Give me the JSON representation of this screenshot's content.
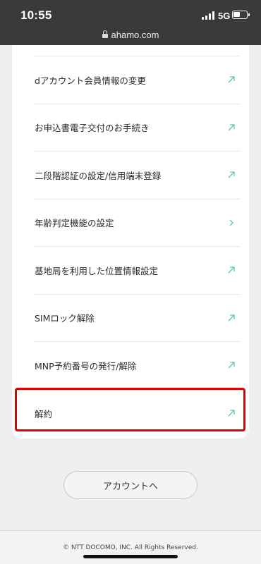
{
  "status_bar": {
    "time": "10:55",
    "network": "5G"
  },
  "browser": {
    "url": "ahamo.com"
  },
  "menu": {
    "items": [
      {
        "label": "dアカウント会員情報の変更",
        "icon": "external-link-arrow-icon"
      },
      {
        "label": "お申込書電子交付のお手続き",
        "icon": "external-link-arrow-icon"
      },
      {
        "label": "二段階認証の設定/信用端末登録",
        "icon": "external-link-arrow-icon"
      },
      {
        "label": "年齢判定機能の設定",
        "icon": "chevron-right-icon"
      },
      {
        "label": "基地局を利用した位置情報設定",
        "icon": "external-link-arrow-icon"
      },
      {
        "label": "SIMロック解除",
        "icon": "external-link-arrow-icon"
      },
      {
        "label": "MNP予約番号の発行/解除",
        "icon": "external-link-arrow-icon"
      },
      {
        "label": "解約",
        "icon": "external-link-arrow-icon"
      }
    ]
  },
  "account_button": {
    "label": "アカウントへ"
  },
  "footer": {
    "copyright": "© NTT DOCOMO, INC. All Rights Reserved."
  },
  "colors": {
    "accent_teal": "#5fc5a8",
    "highlight_red": "#e00000",
    "status_bar_bg": "#3a3a3a"
  }
}
